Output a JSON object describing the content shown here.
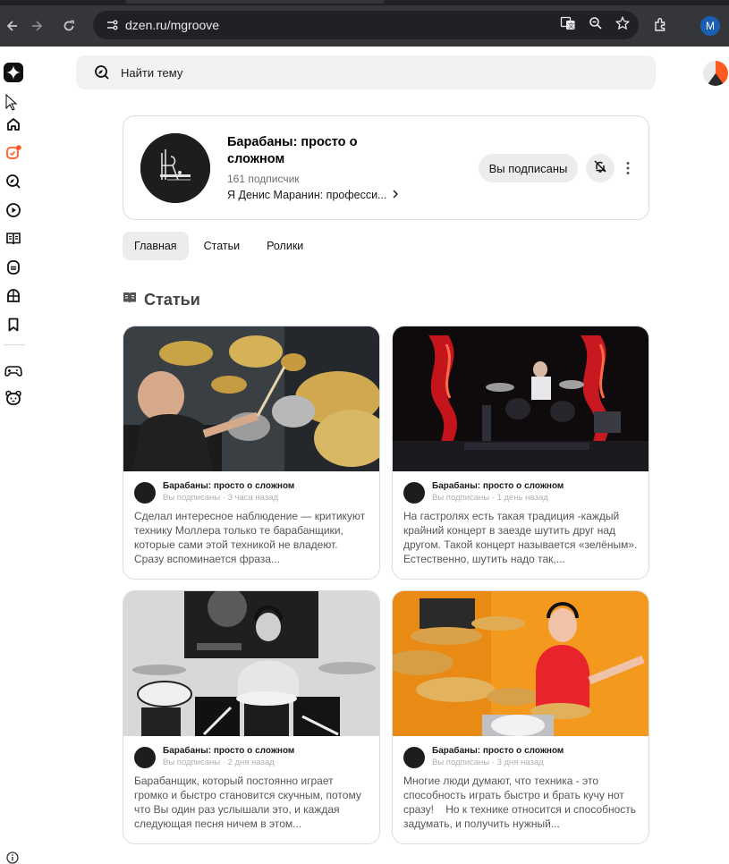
{
  "browser": {
    "url": "dzen.ru/mgroove",
    "profile_initial": "M"
  },
  "search": {
    "placeholder": "Найти тему"
  },
  "channel": {
    "title": "Барабаны: просто о сложном",
    "subscribers": "161 подписчик",
    "description": "Я Денис Маранин: професси...",
    "subscribe_label": "Вы подписаны"
  },
  "tabs": [
    {
      "label": "Главная",
      "active": true
    },
    {
      "label": "Статьи",
      "active": false
    },
    {
      "label": "Ролики",
      "active": false
    }
  ],
  "section": {
    "title": "Статьи"
  },
  "articles": [
    {
      "author": "Барабаны: просто о сложном",
      "status": "Вы подписаны",
      "time": "3 часа назад",
      "excerpt": "Сделал интересное наблюдение — критикуют технику Моллера только те барабанщики, которые сами этой техникой не владеют. Сразу вспоминается фраза..."
    },
    {
      "author": "Барабаны: просто о сложном",
      "status": "Вы подписаны",
      "time": "1 день назад",
      "excerpt": "На гастролях есть такая традиция -каждый крайний концерт в заезде шутить друг над другом. Такой концерт называется «зелёным». Естественно, шутить надо так,..."
    },
    {
      "author": "Барабаны: просто о сложном",
      "status": "Вы подписаны",
      "time": "2 дня назад",
      "excerpt": "Барабанщик, который постоянно играет громко и быстро становится скучным, потому что Вы один раз услышали это, и каждая следующая песня ничем в этом..."
    },
    {
      "author": "Барабаны: просто о сложном",
      "status": "Вы подписаны",
      "time": "3 дня назад",
      "excerpt": "Многие люди думают, что техника - это способность играть быстро и брать кучу нот сразу!    Но к технике относится и способность задумать, и получить нужный..."
    }
  ],
  "colors": {
    "accent": "#ff5a1f",
    "chrome": "#35363a"
  }
}
